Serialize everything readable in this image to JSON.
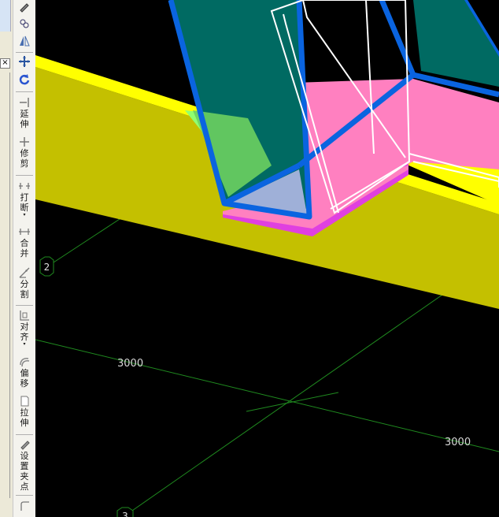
{
  "toolbar": {
    "items": [
      {
        "label": "延伸",
        "icon": "extend-icon"
      },
      {
        "label": "修剪",
        "icon": "trim-icon"
      },
      {
        "label": "打断",
        "icon": "break-icon"
      },
      {
        "label": "合并",
        "icon": "merge-icon"
      },
      {
        "label": "分割",
        "icon": "split-icon"
      },
      {
        "label": "对齐",
        "icon": "align-icon"
      },
      {
        "label": "偏移",
        "icon": "offset-icon"
      },
      {
        "label": "拉伸",
        "icon": "stretch-icon"
      },
      {
        "label": "设置夹点",
        "icon": "set-grip-icon"
      }
    ]
  },
  "panel": {
    "close_label": "×"
  },
  "viewport": {
    "dimensions": [
      "3000",
      "3000"
    ],
    "axis_labels": [
      "2",
      "3"
    ],
    "colors": {
      "beam_yellow": "#c4c000",
      "beam_top": "#ffff00",
      "column_cyan": "#006a62",
      "column_edge": "#0a64e0",
      "slab_pink": "#ff80c0",
      "slab_magenta": "#e040e0",
      "grid_green": "#1f8a1f",
      "wireframe": "#ffffff"
    }
  }
}
